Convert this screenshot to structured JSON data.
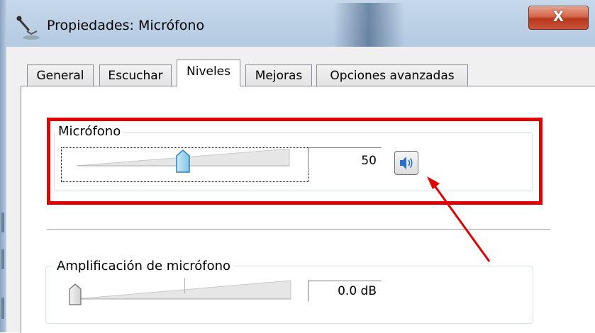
{
  "window": {
    "title": "Propiedades: Micrófono",
    "close_glyph": "X"
  },
  "tabs": [
    {
      "label": "General",
      "active": false
    },
    {
      "label": "Escuchar",
      "active": false
    },
    {
      "label": "Niveles",
      "active": true
    },
    {
      "label": "Mejoras",
      "active": false
    },
    {
      "label": "Opciones avanzadas",
      "active": false
    }
  ],
  "microphone": {
    "label": "Micrófono",
    "value": "50",
    "level": 50,
    "mute_icon": "speaker-icon"
  },
  "boost": {
    "label": "Amplificación de micrófono",
    "value": "0.0 dB",
    "level": 0
  },
  "colors": {
    "highlight": "#e00000",
    "arrow": "#e00000",
    "accent": "#2a6fc9"
  }
}
